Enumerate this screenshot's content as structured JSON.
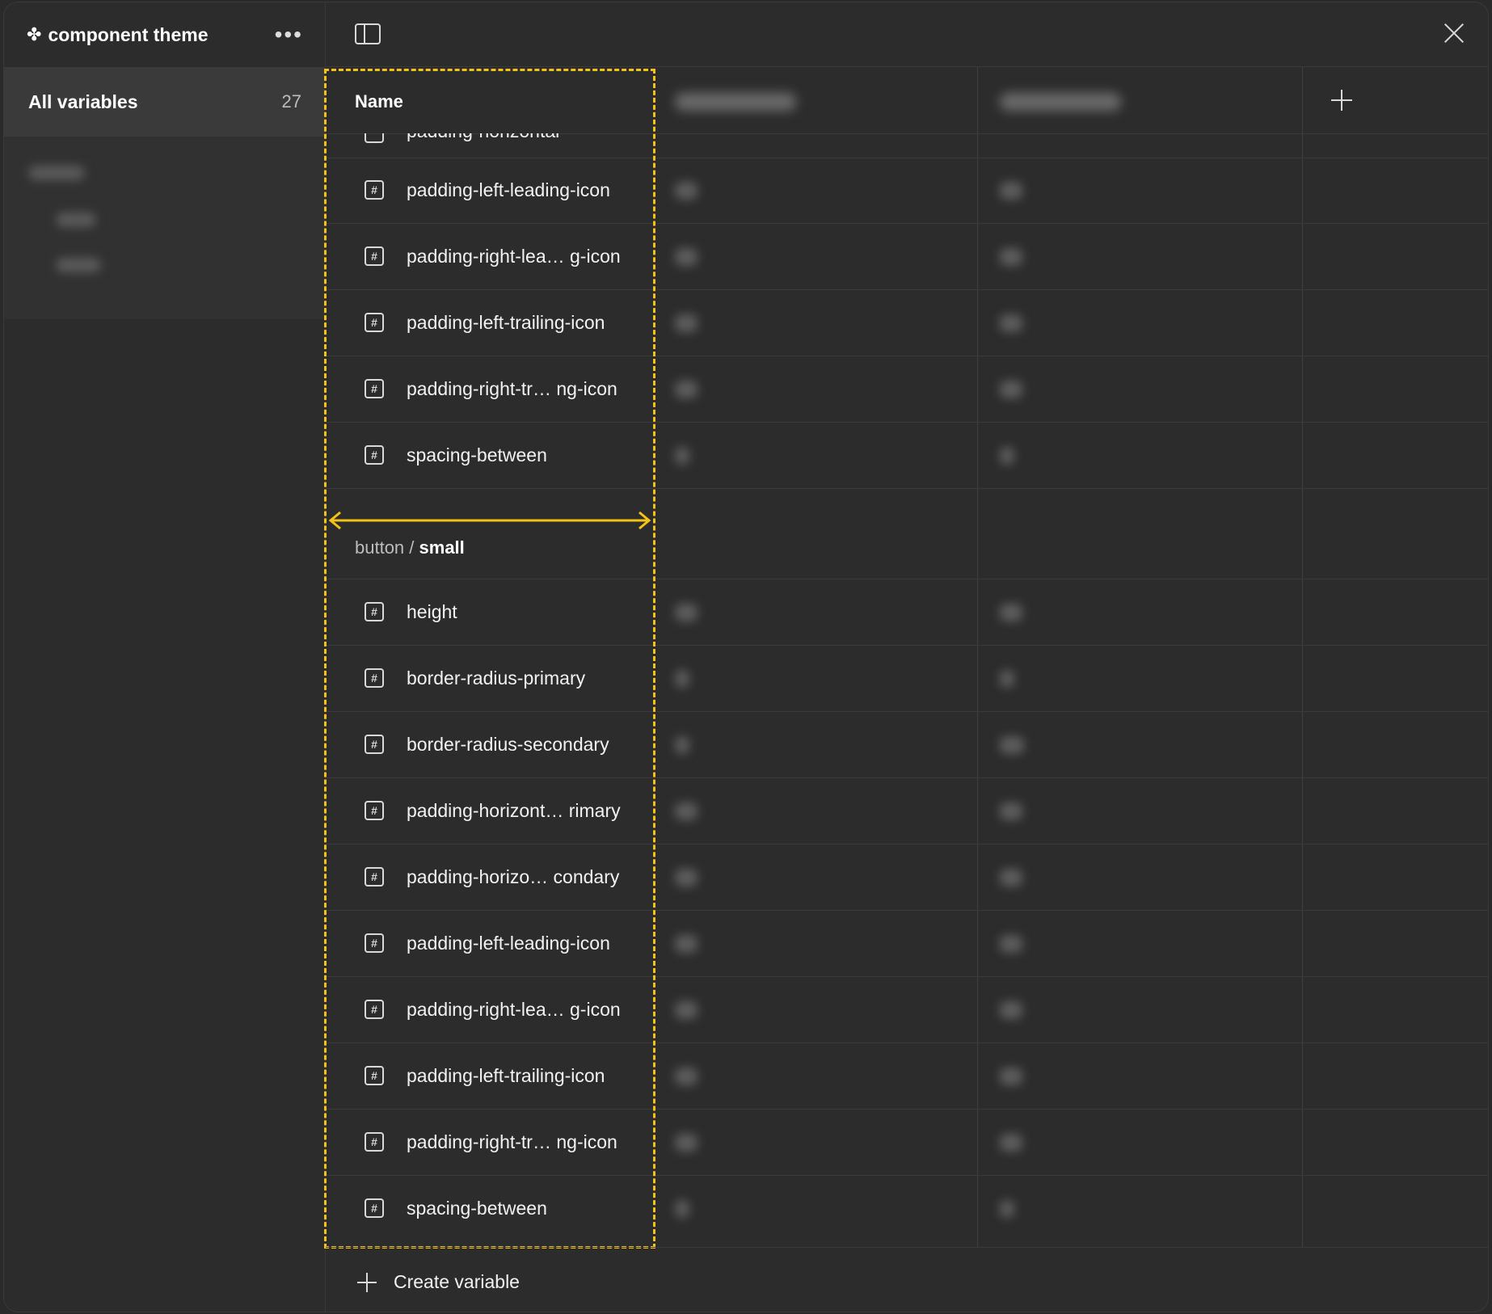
{
  "sidebar": {
    "collection_title": "component theme",
    "all_variables_label": "All variables",
    "all_variables_count": "27"
  },
  "table": {
    "name_header": "Name",
    "partial_top_row": "padding-horizontal",
    "rows_group1": [
      "padding-left-leading-icon",
      "padding-right-lea… g-icon",
      "padding-left-trailing-icon",
      "padding-right-tr… ng-icon",
      "spacing-between"
    ],
    "group_small": {
      "prefix": "button / ",
      "name": "small"
    },
    "rows_group2": [
      "height",
      "border-radius-primary",
      "border-radius-secondary",
      "padding-horizont… rimary",
      "padding-horizo… condary",
      "padding-left-leading-icon",
      "padding-right-lea… g-icon",
      "padding-left-trailing-icon",
      "padding-right-tr… ng-icon",
      "spacing-between"
    ]
  },
  "footer": {
    "create_label": "Create variable"
  },
  "colors": {
    "highlight": "#f2c218",
    "background": "#2c2c2c"
  },
  "icons": [
    "collection-icon",
    "more-icon",
    "panel-toggle-icon",
    "close-icon",
    "number-variable-icon",
    "add-column-icon",
    "plus-icon"
  ]
}
